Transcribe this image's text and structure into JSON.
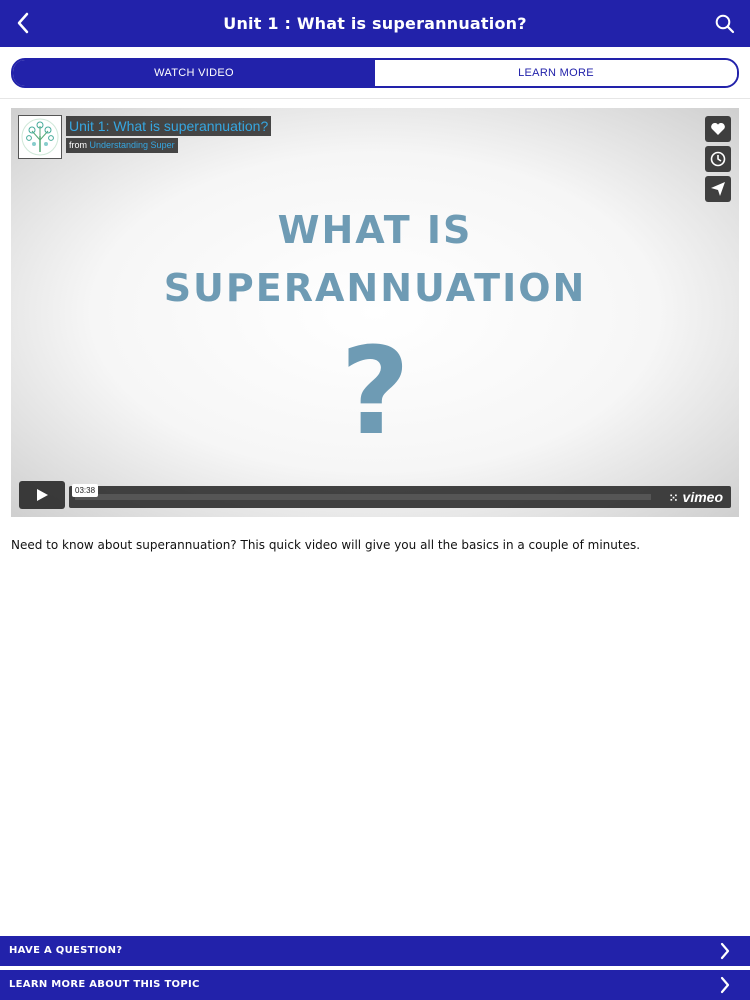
{
  "header": {
    "title": "Unit 1 : What is superannuation?",
    "back_icon": "chevron-left-icon",
    "search_icon": "search-icon"
  },
  "tabs": [
    {
      "label": "WATCH VIDEO",
      "active": true
    },
    {
      "label": "LEARN MORE",
      "active": false
    }
  ],
  "video": {
    "title": "Unit 1: What is superannuation?",
    "from_label": "from",
    "channel": "Understanding Super",
    "headline_line1": "WHAT IS",
    "headline_line2": "SUPERANNUATION",
    "headline_mark": "?",
    "duration": "03:38",
    "brand": "vimeo",
    "side_buttons": [
      "heart-icon",
      "clock-icon",
      "send-icon"
    ]
  },
  "description": "Need to know about superannuation? This quick video will give you all the basics in a couple of minutes.",
  "footer": {
    "question_label": "HAVE A QUESTION?",
    "learn_more_label": "LEARN MORE ABOUT THIS TOPIC"
  },
  "colors": {
    "brand": "#2222aa",
    "vimeo_blue": "#36a6e0",
    "headline": "#6e9bb4"
  }
}
